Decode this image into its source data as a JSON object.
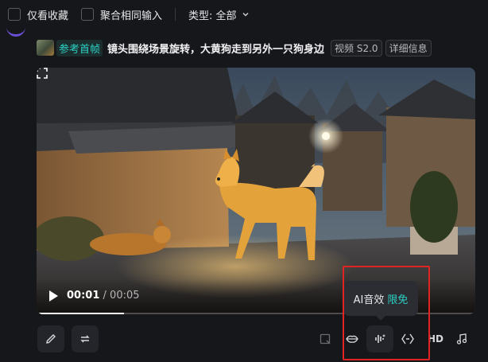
{
  "filters": {
    "only_favorites": "仅看收藏",
    "aggregate_same_input": "聚合相同输入",
    "type_label": "类型: 全部"
  },
  "prompt": {
    "ref_label": "参考首帧",
    "text": "镜头围绕场景旋转，大黄狗走到另外一只狗身边",
    "model_badge": "视频 S2.0",
    "details_badge": "详细信息"
  },
  "player": {
    "current_time": "00:01",
    "separator": " / ",
    "duration": "00:05",
    "progress": 0.2
  },
  "tooltip": {
    "title": "AI音效",
    "tag": "限免"
  },
  "toolbar": {
    "hd_label": "HD"
  },
  "colors": {
    "accent": "#2bd1c4",
    "highlight": "#e02424"
  }
}
